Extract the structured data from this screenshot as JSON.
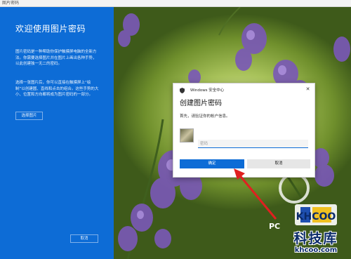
{
  "window": {
    "title": "图片密码"
  },
  "left_panel": {
    "heading": "欢迎使用图片密码",
    "para1": "图片密码是一种帮助你保护触摸屏电脑的全新方法。你需要选择图片并在图片上画出各种手势，以此创建独一无二的密码。",
    "para2": "选择一张图片后，你可以直接在触摸屏上“绘制”以创建圆、直线和点击的组合。这些手势的大小、位置和方向都将成为图片密码的一部分。",
    "choose_button": "选择图片",
    "cancel_button": "取消"
  },
  "dialog": {
    "app_name": "Windows 安全中心",
    "title": "创建图片密码",
    "subtitle": "首先，请验证你的帐户信息。",
    "password_placeholder": "密码",
    "ok_button": "确定",
    "cancel_button": "取消",
    "close_icon": "close-icon"
  },
  "background_text": "PC",
  "watermark": {
    "title": "科技库",
    "url": "khcoo.com"
  },
  "colors": {
    "accent": "#0d6cd6",
    "arrow": "#e02020"
  }
}
